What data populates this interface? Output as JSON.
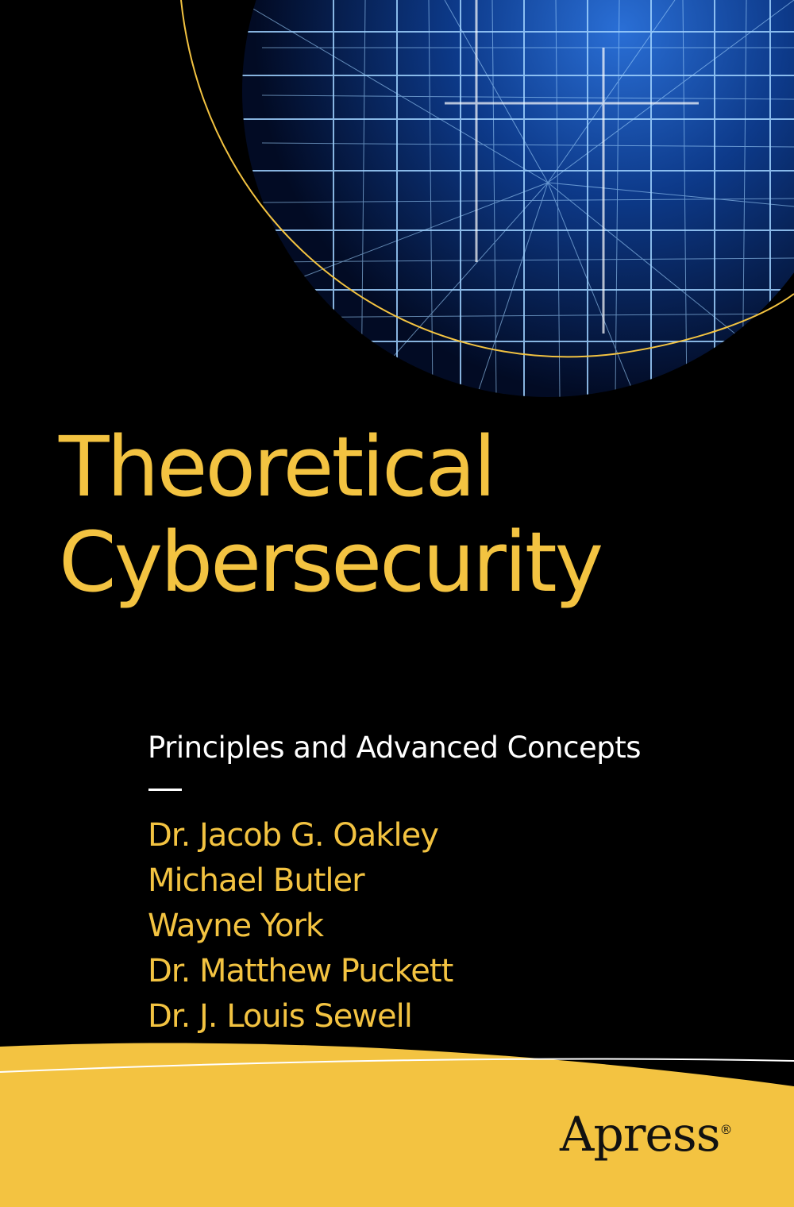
{
  "cover": {
    "title_lines": [
      "Theoretical",
      "Cybersecurity"
    ],
    "subtitle": "Principles and Advanced Concepts",
    "authors": [
      "Dr. Jacob G. Oakley",
      "Michael Butler",
      "Wayne York",
      "Dr. Matthew Puckett",
      "Dr. J. Louis Sewell"
    ],
    "publisher": "Apress",
    "publisher_mark": "®"
  },
  "colors": {
    "background": "#000000",
    "accent_yellow": "#F3C341",
    "subtitle_white": "#FFFFFF",
    "circle_blue": "#0A2A66"
  },
  "icons": [
    "abstract-grid-circle-image",
    "apress-logo"
  ]
}
